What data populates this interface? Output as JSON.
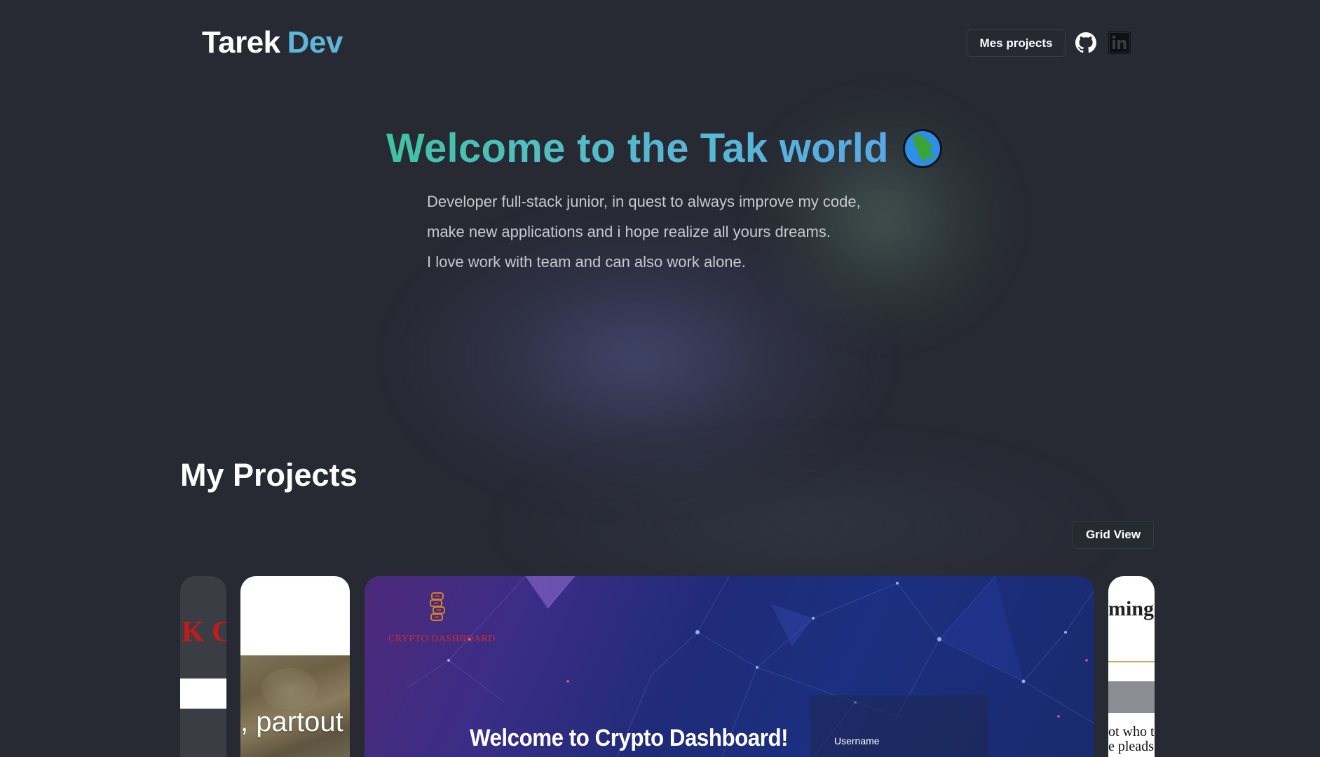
{
  "header": {
    "logo_first": "Tarek",
    "logo_second": "Dev",
    "nav_projects_label": "Mes projects",
    "github_icon": "github-icon",
    "linkedin_icon": "linkedin-icon"
  },
  "hero": {
    "title_part1": "Welcome to the",
    "title_part2": "Tak world",
    "globe_icon": "globe-icon",
    "lines": [
      "Developer full-stack junior, in quest to always improve my code,",
      "make new applications and i hope realize all yours dreams.",
      "I love work with team and can also work alone."
    ]
  },
  "projects": {
    "title": "My Projects",
    "grid_view_label": "Grid View",
    "cards": [
      {
        "visible_text": "K C"
      },
      {
        "visible_text": ", partout"
      },
      {
        "logo_text": "CRYPTO DASHBOARD",
        "headline": "Welcome to Crypto Dashboard!",
        "field_label": "Username"
      },
      {
        "visible_text_top": "ming",
        "visible_text_bottom_1": "ot who t",
        "visible_text_bottom_2": "e pleads"
      }
    ]
  },
  "colors": {
    "background": "#272a33",
    "accent_teal": "#3fc2a0",
    "accent_blue": "#5ab4d3"
  }
}
